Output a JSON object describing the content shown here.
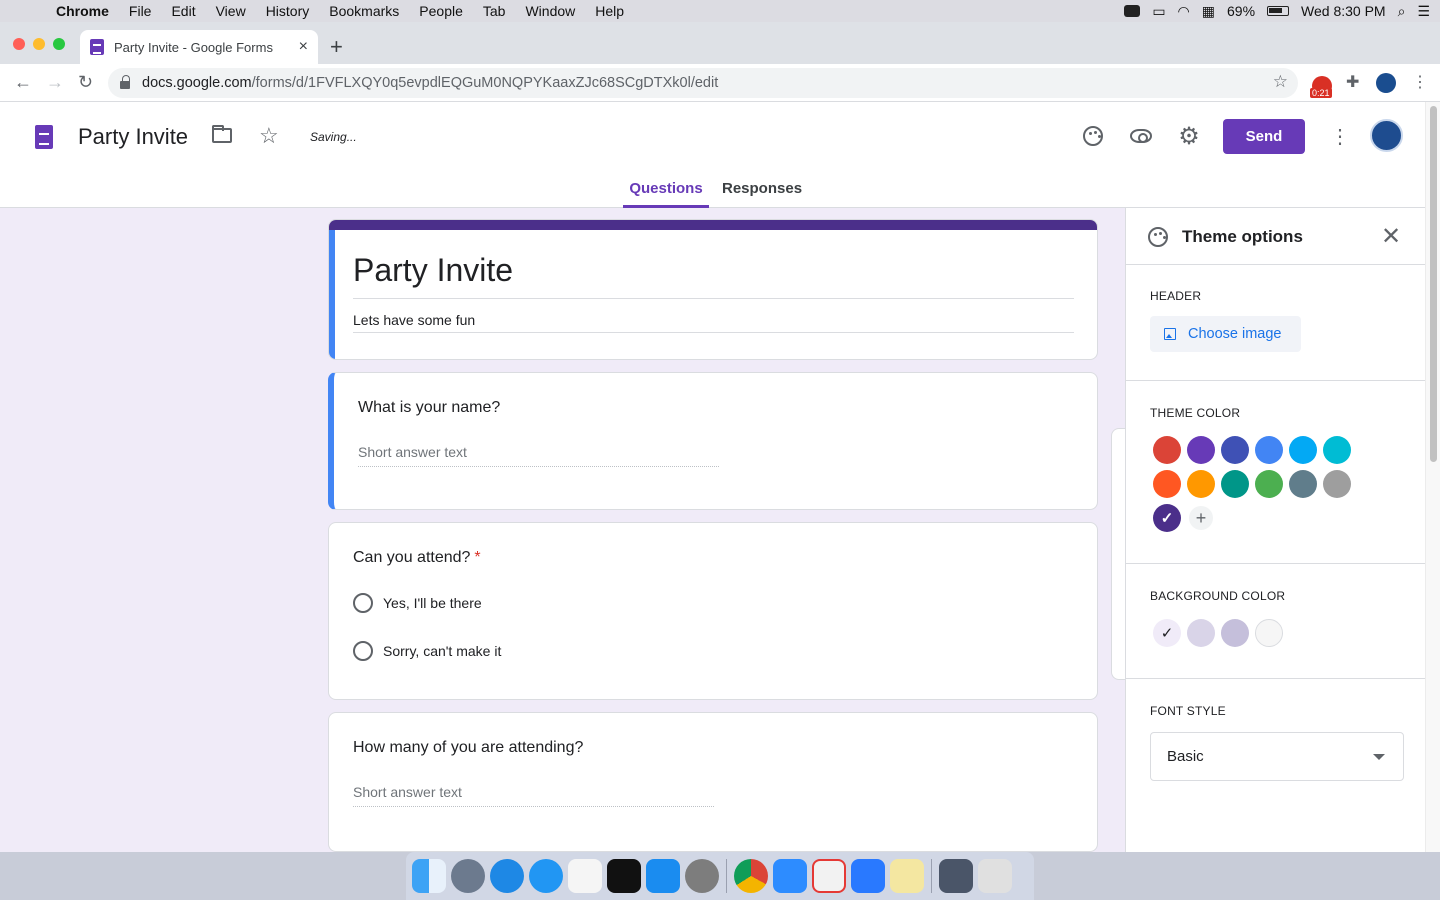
{
  "menubar": {
    "app": "Chrome",
    "items": [
      "File",
      "Edit",
      "View",
      "History",
      "Bookmarks",
      "People",
      "Tab",
      "Window",
      "Help"
    ],
    "battery": "69%",
    "clock": "Wed 8:30 PM"
  },
  "browser": {
    "tab_title": "Party Invite - Google Forms",
    "tab_close": "×",
    "new_tab": "+",
    "url_host": "docs.google.com",
    "url_path": "/forms/d/1FVFLXQY0q5evpdlEQGuM0NQPYKaaxZJc68SCgDTXk0l/edit",
    "ext_badge": "0:21"
  },
  "header": {
    "title": "Party Invite",
    "status": "Saving...",
    "send_label": "Send",
    "tabs": {
      "questions": "Questions",
      "responses": "Responses"
    }
  },
  "form": {
    "title": "Party Invite",
    "description": "Lets have some fun",
    "questions": [
      {
        "title": "What is your name?",
        "type": "short",
        "placeholder": "Short answer text"
      },
      {
        "title": "Can you attend?",
        "required": "*",
        "options": [
          "Yes,  I'll be there",
          "Sorry, can't make it"
        ]
      },
      {
        "title": "How many of you are attending?",
        "type": "short",
        "placeholder": "Short answer text"
      }
    ]
  },
  "theme_panel": {
    "title": "Theme options",
    "header_label": "HEADER",
    "choose_image": "Choose image",
    "theme_color_label": "THEME COLOR",
    "theme_colors": [
      "#db4437",
      "#673ab7",
      "#3f51b5",
      "#4285f4",
      "#03a9f4",
      "#00bcd4",
      "#ff5722",
      "#ff9800",
      "#009688",
      "#4caf50",
      "#607d8b",
      "#9e9e9e",
      "#4b2f8a"
    ],
    "selected_theme_color": "#4b2f8a",
    "background_color_label": "BACKGROUND COLOR",
    "background_colors": [
      "#f0ebf8",
      "#d9d4e8",
      "#c5bfdb",
      "#f6f6f6"
    ],
    "font_style_label": "FONT STYLE",
    "font_style_value": "Basic"
  },
  "dock": {
    "icons": [
      "finder-icon",
      "launchpad-icon",
      "safari-icon",
      "messages-icon",
      "music-icon",
      "tv-icon",
      "app-store-icon",
      "system-preferences-icon",
      "chrome-icon",
      "zoom-icon",
      "screen-share-icon",
      "keynote-icon",
      "notes-icon",
      "downloads-icon",
      "trash-icon"
    ]
  }
}
